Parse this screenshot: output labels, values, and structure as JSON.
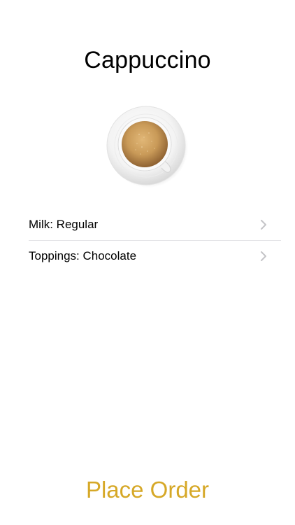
{
  "title": "Cappuccino",
  "image": {
    "icon": "coffee-cup-icon"
  },
  "options": [
    {
      "label": "Milk: Regular"
    },
    {
      "label": "Toppings: Chocolate"
    }
  ],
  "place_order_label": "Place Order",
  "colors": {
    "accent": "#d6a827",
    "separator": "#e3e3e6",
    "chevron": "#c4c4c7"
  }
}
